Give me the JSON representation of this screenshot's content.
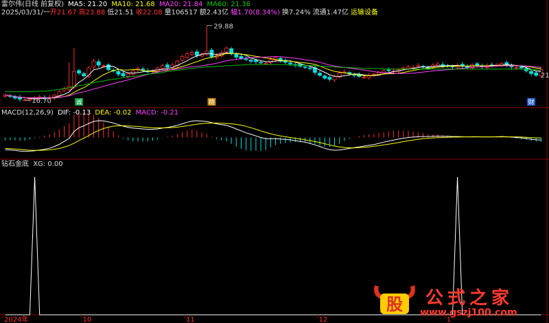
{
  "main_header": {
    "title": "雷尔伟(日线 前复权)",
    "ma5": "MA5: 21.20",
    "ma10": "MA10: 21.68",
    "ma20": "MA20: 21.84",
    "ma60": "MA60: 21.36"
  },
  "info_line": {
    "date": "2025/03/31/一",
    "open": "开21.67",
    "high": "高23.88",
    "low": "低21.51",
    "close": "收22.08",
    "volume": "量106517",
    "amount": "额2.43亿",
    "range": "幅1.70(8.34%)",
    "turnover": "换7.24%",
    "float": "流通1.47亿",
    "sector": "运输设备"
  },
  "macd_header": {
    "title": "MACD(12,26,9)",
    "dif": "DIF: -0.13",
    "dea": "DEA: -0.02",
    "macd": "MACD: -0.21"
  },
  "xg_header": {
    "title": "钻石金底",
    "xg": "XG: 0.00"
  },
  "watermark": {
    "logo_char": "股",
    "text": "公式之家",
    "url": "www.gszj100.com"
  },
  "colors": {
    "up": "#ff3030",
    "down": "#00e0e0",
    "ma5": "#ffffff",
    "ma10": "#ffff00",
    "ma20": "#ff40ff",
    "ma60": "#00c000",
    "grid": "#8b0000"
  },
  "chart_data": [
    {
      "type": "candlestick",
      "title": "雷尔伟(日线 前复权)",
      "annotations": [
        {
          "label": "29.88",
          "kind": "high"
        },
        {
          "label": "16.70",
          "kind": "low"
        },
        {
          "label": "21",
          "kind": "right-edge"
        }
      ],
      "markers": [
        "诚",
        "精",
        "财"
      ],
      "ylim": [
        16,
        31
      ],
      "close": [
        17.6,
        17.4,
        17.1,
        16.9,
        16.8,
        16.9,
        17.1,
        17.3,
        17.0,
        17.2,
        17.6,
        18.2,
        18.7,
        19.1,
        21.8,
        21.5,
        21.0,
        22.4,
        23.6,
        22.9,
        22.8,
        22.1,
        21.9,
        21.3,
        21.0,
        21.4,
        21.9,
        22.3,
        22.0,
        21.7,
        21.9,
        22.4,
        22.8,
        22.5,
        22.9,
        23.6,
        24.4,
        24.9,
        25.1,
        24.6,
        24.9,
        25.4,
        24.4,
        24.6,
        25.1,
        25.9,
        24.9,
        24.3,
        24.1,
        23.9,
        23.6,
        23.5,
        23.3,
        23.2,
        23.9,
        24.2,
        23.6,
        23.4,
        23.1,
        22.9,
        22.7,
        22.5,
        22.3,
        21.6,
        21.1,
        20.6,
        20.4,
        20.9,
        21.5,
        21.7,
        21.4,
        21.1,
        20.9,
        20.8,
        21.1,
        21.3,
        21.6,
        21.9,
        22.0,
        21.9,
        22.1,
        22.4,
        22.6,
        22.5,
        22.8,
        22.6,
        22.4,
        22.9,
        23.1,
        22.7,
        22.8,
        22.6,
        22.9,
        22.7,
        22.5,
        23.0,
        22.9,
        22.6,
        22.8,
        22.9,
        23.0,
        23.2,
        22.9,
        22.6,
        22.5,
        22.4,
        21.9,
        21.4,
        21.1,
        22.1
      ],
      "ma60": [
        18.2,
        18.2,
        18.2,
        18.2,
        18.2,
        18.2,
        18.2,
        18.3,
        18.3,
        18.4,
        18.5,
        18.6,
        18.8,
        18.9,
        19.1,
        19.3,
        19.4,
        19.6,
        19.8,
        20.0,
        20.1,
        20.3,
        20.4,
        20.5,
        20.7,
        20.8,
        20.9,
        21.0,
        21.2,
        21.3,
        21.4,
        21.5,
        21.6,
        21.8,
        21.9,
        22.0,
        22.1,
        22.2,
        22.3,
        22.4,
        22.5,
        22.6,
        22.6,
        22.7,
        22.7,
        22.8,
        22.8,
        22.9,
        22.9,
        23.0,
        23.0,
        23.0,
        23.0,
        23.0,
        23.0,
        23.0,
        23.0,
        23.0,
        22.9,
        22.9,
        22.9,
        22.9,
        22.8,
        22.8,
        22.7,
        22.7,
        22.6,
        22.6,
        22.5,
        22.5,
        22.5,
        22.4,
        22.4,
        22.3,
        22.3,
        22.3,
        22.3,
        22.2,
        22.2,
        22.2,
        22.2,
        22.2,
        22.2,
        22.2,
        22.2,
        22.2,
        22.2,
        22.2,
        22.2,
        22.2,
        22.2,
        22.2,
        22.2,
        22.2,
        22.2,
        22.2,
        22.2,
        22.2,
        22.2,
        22.2,
        22.2,
        22.2,
        22.2,
        22.2,
        22.2,
        22.2,
        22.1,
        22.1,
        22.1,
        22.0
      ]
    },
    {
      "type": "line",
      "title": "MACD(12,26,9)",
      "dif": [
        -0.62,
        -0.64,
        -0.66,
        -0.69,
        -0.71,
        -0.7,
        -0.68,
        -0.64,
        -0.6,
        -0.55,
        -0.46,
        -0.35,
        -0.2,
        -0.05,
        0.3,
        0.5,
        0.6,
        0.72,
        0.82,
        0.86,
        0.85,
        0.8,
        0.74,
        0.66,
        0.58,
        0.52,
        0.48,
        0.46,
        0.44,
        0.42,
        0.42,
        0.44,
        0.48,
        0.52,
        0.56,
        0.62,
        0.7,
        0.78,
        0.84,
        0.86,
        0.84,
        0.82,
        0.76,
        0.7,
        0.66,
        0.62,
        0.54,
        0.44,
        0.34,
        0.24,
        0.16,
        0.08,
        0.0,
        -0.06,
        -0.06,
        -0.06,
        -0.08,
        -0.1,
        -0.12,
        -0.16,
        -0.2,
        -0.24,
        -0.3,
        -0.38,
        -0.46,
        -0.55,
        -0.62,
        -0.65,
        -0.64,
        -0.6,
        -0.56,
        -0.52,
        -0.48,
        -0.44,
        -0.4,
        -0.36,
        -0.3,
        -0.24,
        -0.18,
        -0.13,
        -0.08,
        -0.04,
        0.0,
        0.02,
        0.04,
        0.05,
        0.05,
        0.06,
        0.07,
        0.06,
        0.06,
        0.05,
        0.05,
        0.04,
        0.03,
        0.04,
        0.04,
        0.03,
        0.03,
        0.03,
        0.04,
        0.05,
        0.04,
        0.02,
        0.0,
        -0.02,
        -0.05,
        -0.09,
        -0.12,
        -0.13
      ],
      "dea": [
        -0.55,
        -0.57,
        -0.59,
        -0.61,
        -0.63,
        -0.65,
        -0.66,
        -0.66,
        -0.65,
        -0.63,
        -0.6,
        -0.56,
        -0.49,
        -0.41,
        -0.29,
        -0.16,
        -0.04,
        0.1,
        0.24,
        0.36,
        0.46,
        0.53,
        0.58,
        0.6,
        0.6,
        0.59,
        0.58,
        0.56,
        0.54,
        0.52,
        0.5,
        0.49,
        0.49,
        0.5,
        0.51,
        0.53,
        0.56,
        0.6,
        0.64,
        0.68,
        0.71,
        0.73,
        0.74,
        0.74,
        0.73,
        0.72,
        0.7,
        0.67,
        0.63,
        0.57,
        0.5,
        0.42,
        0.34,
        0.26,
        0.19,
        0.13,
        0.08,
        0.04,
        0.0,
        -0.04,
        -0.08,
        -0.12,
        -0.16,
        -0.21,
        -0.26,
        -0.32,
        -0.38,
        -0.44,
        -0.48,
        -0.51,
        -0.53,
        -0.53,
        -0.52,
        -0.5,
        -0.48,
        -0.45,
        -0.42,
        -0.38,
        -0.34,
        -0.3,
        -0.26,
        -0.21,
        -0.17,
        -0.13,
        -0.09,
        -0.06,
        -0.04,
        -0.02,
        -0.01,
        0.0,
        0.01,
        0.02,
        0.02,
        0.03,
        0.03,
        0.03,
        0.03,
        0.03,
        0.03,
        0.03,
        0.03,
        0.03,
        0.03,
        0.03,
        0.03,
        0.02,
        0.01,
        -0.01,
        -0.02,
        -0.02
      ],
      "ylim": [
        -1.0,
        1.0
      ]
    },
    {
      "type": "line",
      "title": "钻石金底",
      "series": [
        {
          "name": "XG",
          "values": [
            0,
            0,
            0,
            0,
            0,
            0,
            0,
            0,
            0,
            0,
            0,
            0,
            0,
            0,
            0,
            0,
            0,
            0,
            0,
            0,
            0,
            0,
            0,
            0,
            0,
            0,
            0,
            0,
            0,
            0,
            0,
            0,
            0,
            0,
            0,
            0,
            0,
            0,
            0,
            0,
            0,
            0,
            0,
            0,
            0,
            0,
            0,
            0,
            0,
            0,
            0,
            0,
            0,
            0,
            0,
            0,
            0,
            0,
            0,
            0,
            0,
            0,
            0,
            0,
            0,
            0,
            0,
            0,
            0,
            0,
            0,
            0,
            0,
            0,
            0,
            0,
            0,
            0,
            0,
            0,
            0,
            0,
            0,
            0,
            0,
            0,
            0,
            0,
            0,
            0,
            0,
            0,
            0,
            0,
            0,
            0,
            0,
            0,
            0,
            0,
            0,
            0,
            0,
            0,
            0,
            0,
            0,
            0,
            0,
            0
          ]
        }
      ],
      "spikes": [
        {
          "bar": 6,
          "value": 1
        },
        {
          "bar": 92,
          "value": 1
        }
      ],
      "ylim": [
        0,
        1.05
      ]
    }
  ],
  "x_axis": {
    "labels": [
      "2024年",
      "10",
      "11",
      "12",
      "1"
    ],
    "label_bars": [
      0,
      16,
      37,
      64,
      90
    ]
  }
}
